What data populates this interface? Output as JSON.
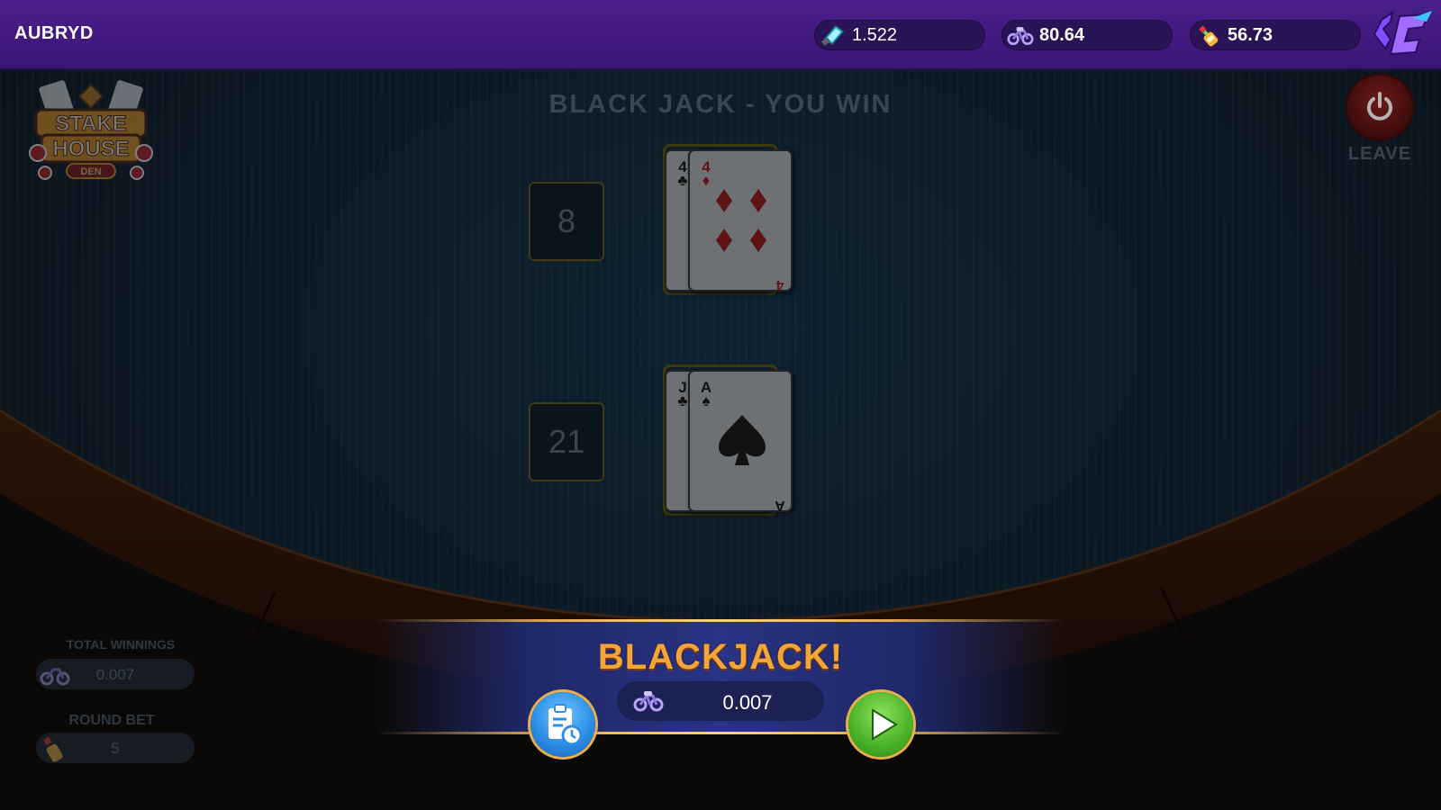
{
  "header": {
    "username": "AUBRYD",
    "balances": [
      {
        "icon": "gem-currency-icon",
        "value": "1.522"
      },
      {
        "icon": "bike-currency-icon",
        "value": "80.64"
      },
      {
        "icon": "bottle-currency-icon",
        "value": "56.73"
      }
    ],
    "brand_icon": "app-logo-icon"
  },
  "table": {
    "status": "BLACK JACK - YOU WIN",
    "leave_label": "LEAVE",
    "dealer": {
      "score": "8",
      "cards": [
        {
          "rank": "4",
          "suit": "♣",
          "face_down_under": true
        },
        {
          "rank": "4",
          "suit": "♦"
        }
      ]
    },
    "player": {
      "score": "21",
      "cards": [
        {
          "rank": "J",
          "suit": "♣"
        },
        {
          "rank": "A",
          "suit": "♠"
        }
      ]
    }
  },
  "stats": {
    "total_winnings_label": "TOTAL WINNINGS",
    "total_winnings_value": "0.007",
    "round_bet_label": "ROUND BET",
    "round_bet_value": "5"
  },
  "result": {
    "title": "BLACKJACK!",
    "amount": "0.007"
  },
  "colors": {
    "header_purple": "#4a1f8a",
    "banner_gold": "#f3a53a",
    "history_blue": "#2c8fe6",
    "play_green": "#4cb52a"
  }
}
